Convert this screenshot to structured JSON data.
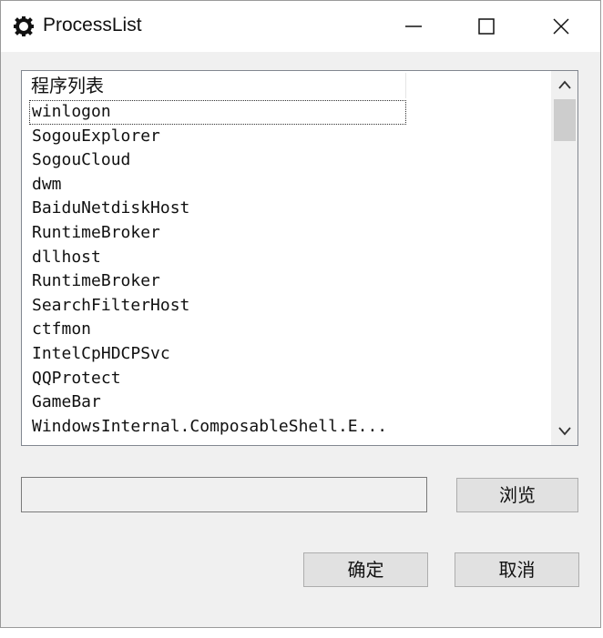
{
  "window": {
    "title": "ProcessList",
    "icon": "gear-icon"
  },
  "list": {
    "header": "程序列表",
    "items": [
      "winlogon",
      "SogouExplorer",
      "SogouCloud",
      "dwm",
      "BaiduNetdiskHost",
      "RuntimeBroker",
      "dllhost",
      "RuntimeBroker",
      "SearchFilterHost",
      "ctfmon",
      "IntelCpHDCPSvc",
      "QQProtect",
      "GameBar",
      "WindowsInternal.ComposableShell.E..."
    ]
  },
  "path_field": {
    "value": ""
  },
  "buttons": {
    "browse": "浏览",
    "ok": "确定",
    "cancel": "取消"
  }
}
